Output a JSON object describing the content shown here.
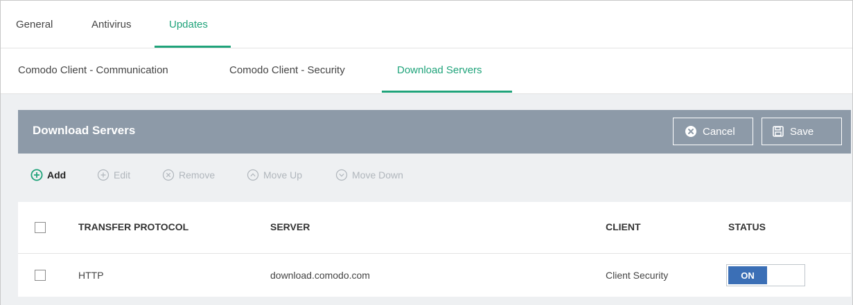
{
  "top_tabs": [
    {
      "label": "General"
    },
    {
      "label": "Antivirus"
    },
    {
      "label": "Updates"
    }
  ],
  "sub_tabs": [
    {
      "label": "Comodo Client - Communication"
    },
    {
      "label": "Comodo Client - Security"
    },
    {
      "label": "Download Servers"
    }
  ],
  "panel": {
    "title": "Download Servers",
    "cancel_label": "Cancel",
    "save_label": "Save"
  },
  "toolbar": {
    "add": "Add",
    "edit": "Edit",
    "remove": "Remove",
    "move_up": "Move Up",
    "move_down": "Move Down"
  },
  "table": {
    "columns": [
      "TRANSFER PROTOCOL",
      "SERVER",
      "CLIENT",
      "STATUS"
    ],
    "rows": [
      {
        "protocol": "HTTP",
        "server": "download.comodo.com",
        "client": "Client Security",
        "status": "ON"
      }
    ]
  },
  "colors": {
    "accent": "#1fa37a",
    "panel_header": "#8d9aa8",
    "toggle_on": "#3b6fb6"
  }
}
